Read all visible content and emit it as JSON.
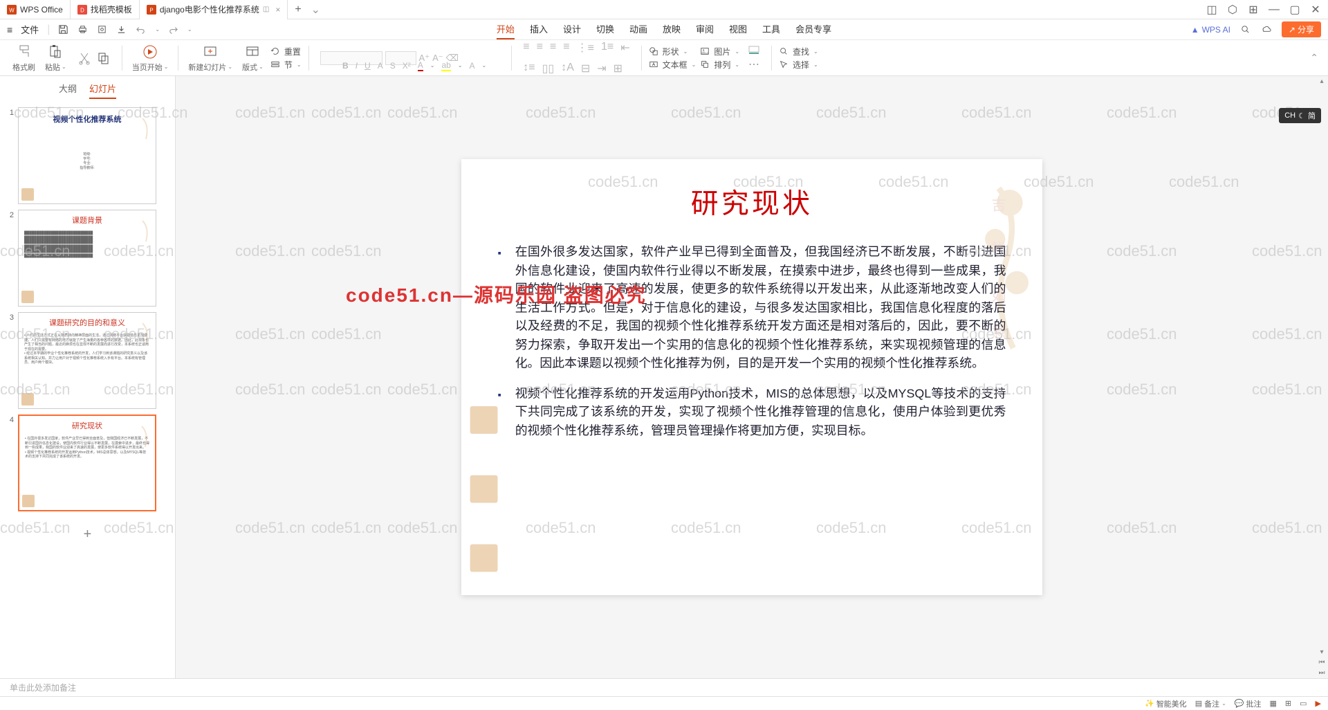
{
  "titlebar": {
    "tabs": [
      {
        "label": "WPS Office",
        "icon": "wps"
      },
      {
        "label": "找稻壳模板",
        "icon": "template"
      },
      {
        "label": "django电影个性化推荐系统",
        "icon": "ppt",
        "active": true
      }
    ]
  },
  "menubar": {
    "file": "文件",
    "tabs": [
      "开始",
      "插入",
      "设计",
      "切换",
      "动画",
      "放映",
      "审阅",
      "视图",
      "工具",
      "会员专享"
    ],
    "active_tab": "开始",
    "wps_ai": "WPS AI",
    "share": "分享"
  },
  "ribbon": {
    "format_painter": "格式刷",
    "paste": "粘贴",
    "from_current": "当页开始",
    "new_slide": "新建幻灯片",
    "layout": "版式",
    "section": "节",
    "reset": "重置",
    "shape": "形状",
    "picture": "图片",
    "textbox": "文本框",
    "arrange": "排列",
    "find": "查找",
    "select": "选择"
  },
  "panel": {
    "tabs": [
      "大纲",
      "幻灯片"
    ],
    "active_tab": "幻灯片",
    "thumbs": [
      {
        "num": "1",
        "title": "视频个性化推荐系统",
        "sub": ""
      },
      {
        "num": "2",
        "title": "课题背景",
        "red": true
      },
      {
        "num": "3",
        "title": "课题研究的目的和意义",
        "red": true
      },
      {
        "num": "4",
        "title": "研究现状",
        "red": true,
        "selected": true
      }
    ]
  },
  "slide": {
    "title": "研究现状",
    "bullets": [
      "在国外很多发达国家，软件产业早已得到全面普及，但我国经济已不断发展，不断引进国外信息化建设，使国内软件行业得以不断发展，在摸索中进步，最终也得到一些成果，我国的软件业迎来了高速的发展，使更多的软件系统得以开发出来，从此逐渐地改变人们的生活工作方式。但是，对于信息化的建设，与很多发达国家相比，我国信息化程度的落后以及经费的不足，我国的视频个性化推荐系统开发方面还是相对落后的，因此，要不断的努力探索，争取开发出一个实用的信息化的视频个性化推荐系统，来实现视频管理的信息化。因此本课题以视频个性化推荐为例，目的是开发一个实用的视频个性化推荐系统。",
      "视频个性化推荐系统的开发运用Python技术，MIS的总体思想，以及MYSQL等技术的支持下共同完成了该系统的开发，实现了视频个性化推荐管理的信息化，使用户体验到更优秀的视频个性化推荐系统，管理员管理操作将更加方便，实现目标。"
    ]
  },
  "notes": {
    "placeholder": "单击此处添加备注"
  },
  "statusbar": {
    "smart_beautify": "智能美化",
    "notes": "备注",
    "comments": "批注"
  },
  "ime": {
    "label": "CH",
    "mode": "简"
  },
  "watermark": {
    "text": "code51.cn",
    "overlay": "code51.cn—源码乐园 盗图必究"
  }
}
